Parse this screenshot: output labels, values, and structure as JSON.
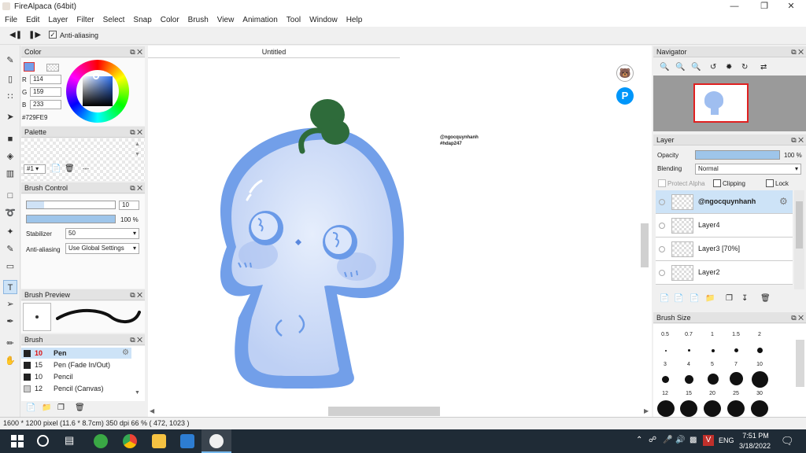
{
  "window": {
    "title": "FireAlpaca (64bit)"
  },
  "menu": [
    "File",
    "Edit",
    "Layer",
    "Filter",
    "Select",
    "Snap",
    "Color",
    "Brush",
    "View",
    "Animation",
    "Tool",
    "Window",
    "Help"
  ],
  "toolbar": {
    "antialias_label": "Anti-aliasing"
  },
  "color_panel": {
    "title": "Color",
    "r_label": "R",
    "g_label": "G",
    "b_label": "B",
    "r": "114",
    "g": "159",
    "b": "233",
    "hex": "#729FE9",
    "current_color": "#729FE9"
  },
  "palette_panel": {
    "title": "Palette",
    "selector": "#1",
    "extra": "---"
  },
  "brush_control": {
    "title": "Brush Control",
    "size": "10",
    "opacity": "100 %",
    "stabilizer_label": "Stabilizer",
    "stabilizer": "50",
    "antialias_label": "Anti-aliasing",
    "antialias": "Use Global Settings"
  },
  "brush_preview": {
    "title": "Brush Preview"
  },
  "brush_panel": {
    "title": "Brush",
    "items": [
      {
        "size": "10",
        "name": "Pen"
      },
      {
        "size": "15",
        "name": "Pen (Fade In/Out)"
      },
      {
        "size": "10",
        "name": "Pencil"
      },
      {
        "size": "12",
        "name": "Pencil (Canvas)"
      }
    ]
  },
  "canvas": {
    "tab": "Untitled",
    "watermark_line1": "@ngocquynhanh",
    "watermark_line2": "#hdap247"
  },
  "navigator": {
    "title": "Navigator"
  },
  "layer_panel": {
    "title": "Layer",
    "opacity_label": "Opacity",
    "opacity": "100 %",
    "blending_label": "Blending",
    "blending": "Normal",
    "protect_alpha": "Protect Alpha",
    "clipping": "Clipping",
    "lock": "Lock",
    "layers": [
      "@ngocquynhanh",
      "Layer4",
      "Layer3 [70%]",
      "Layer2"
    ]
  },
  "brush_size": {
    "title": "Brush Size",
    "sizes": [
      "0.5",
      "0.7",
      "1",
      "1.5",
      "2",
      "3",
      "4",
      "5",
      "7",
      "10",
      "12",
      "15",
      "20",
      "25",
      "30"
    ]
  },
  "status": {
    "text": "1600 * 1200 pixel   (11.6 * 8.7cm)   350 dpi   66 %   ( 472, 1023 )"
  },
  "taskbar": {
    "lang": "ENG",
    "time": "7:51 PM",
    "date": "3/18/2022"
  },
  "colors": {
    "accent": "#729FE9",
    "sprout": "#2e6b3a",
    "taskbar": "#1f2b36"
  }
}
